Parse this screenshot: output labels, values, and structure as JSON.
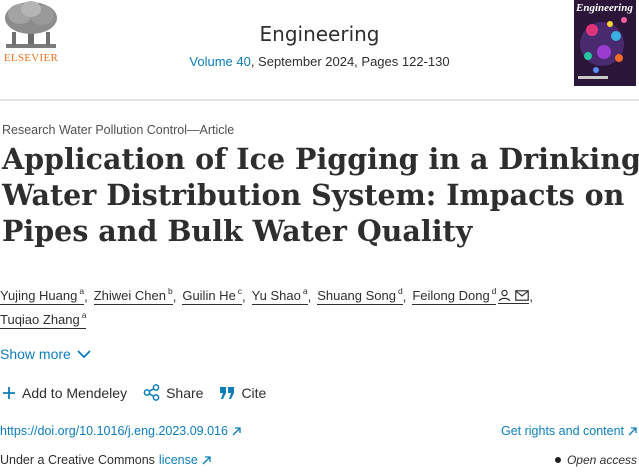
{
  "header": {
    "publisher": "ELSEVIER",
    "journal_title": "Engineering",
    "volume_link": "Volume 40",
    "issue_info": ", September 2024, Pages 122-130",
    "cover_title": "Engineering"
  },
  "article": {
    "type": "Research Water Pollution Control—Article",
    "title_lines": [
      "Application of Ice Pigging in a Drinking",
      "Water Distribution System: Impacts on",
      "Pipes and Bulk Water Quality"
    ]
  },
  "authors": [
    {
      "name": "Yujing Huang",
      "sup": "a"
    },
    {
      "name": "Zhiwei Chen",
      "sup": "b"
    },
    {
      "name": "Guilin He",
      "sup": "c"
    },
    {
      "name": "Yu Shao",
      "sup": "a"
    },
    {
      "name": "Shuang Song",
      "sup": "d"
    },
    {
      "name": "Feilong Dong",
      "sup": "d"
    },
    {
      "name": "Tuqiao Zhang",
      "sup": "a"
    }
  ],
  "show_more": "Show more",
  "actions": {
    "mendeley": "Add to Mendeley",
    "share": "Share",
    "cite": "Cite"
  },
  "links": {
    "doi": "https://doi.org/10.1016/j.eng.2023.09.016",
    "rights": "Get rights and content",
    "license_prefix": "Under a Creative Commons",
    "license_link": "license",
    "open_access": "Open access"
  },
  "colors": {
    "link": "#0c7dbb",
    "publisher_orange": "#e9711c",
    "text": "#2e2e2e"
  }
}
